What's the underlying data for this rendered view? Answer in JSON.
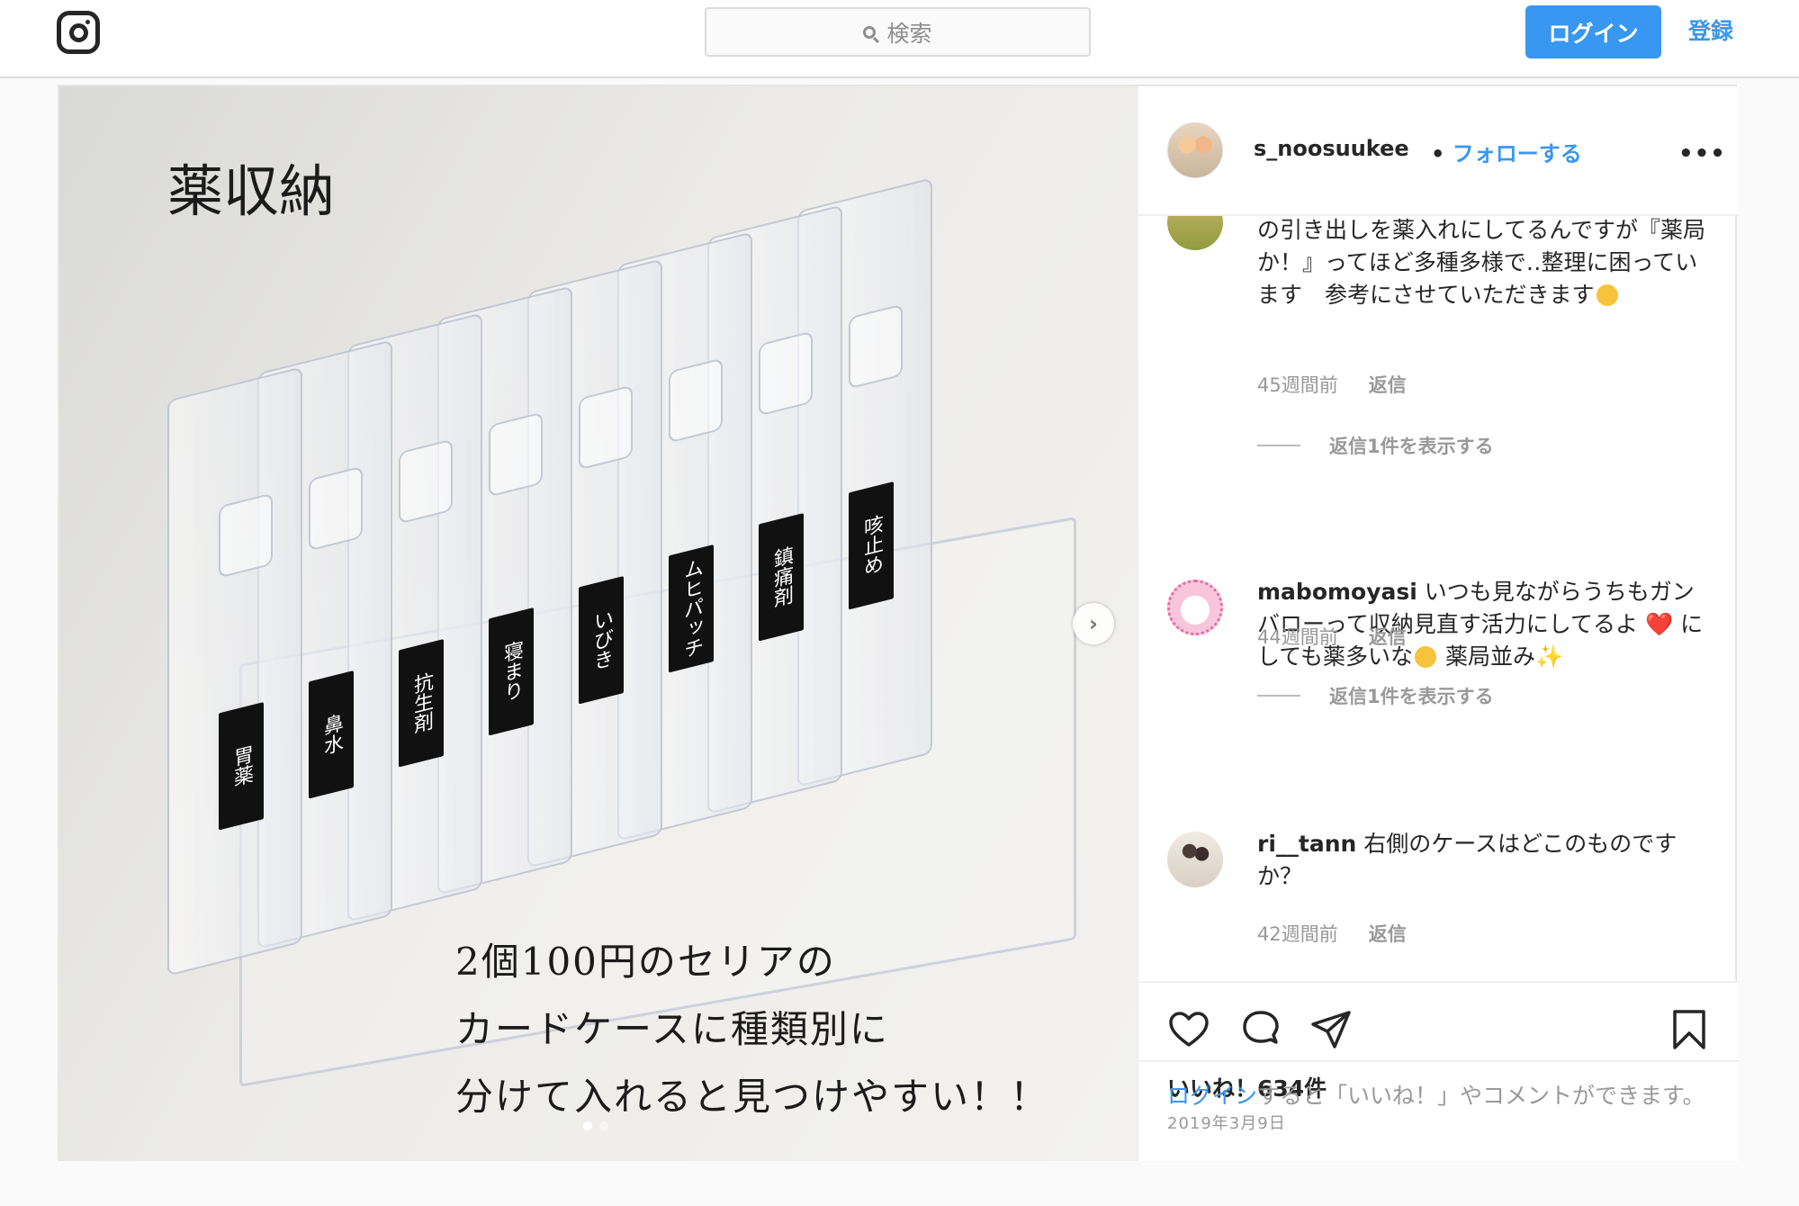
{
  "nav": {
    "search_placeholder": "検索",
    "login_label": "ログイン",
    "signup_label": "登録"
  },
  "media": {
    "title": "薬収納",
    "caption_lines": [
      "2個100円のセリアの",
      "カードケースに種類別に",
      "分けて入れると見つけやすい！！"
    ],
    "case_labels": [
      "胃薬",
      "鼻水",
      "抗生剤",
      "寝まり",
      "いびき",
      "ムヒパッチ",
      "鎮痛剤",
      "咳止め"
    ],
    "carousel": {
      "count": 2,
      "active": 0
    }
  },
  "post_header": {
    "username": "s_noosuukee",
    "separator": "•",
    "follow_label": "フォローする",
    "more_icon": "more-dots-icon"
  },
  "comments": [
    {
      "text": "の引き出しを薬入れにしてるんですが『薬局か！』ってほど多種多様で‥整理に困っています　参考にさせていただきます",
      "emoji": "grinning-emoji",
      "time": "45週間前",
      "reply_label": "返信",
      "view_replies": "返信1件を表示する"
    },
    {
      "username": "mabomoyasi",
      "text_a": "いつも見ながらうちもガンバローって収納見直す活力にしてるよ",
      "heart": "❤️",
      "text_b": "にしても薬多いな",
      "text_c": "薬局並み",
      "sparkle": "✨",
      "time": "44週間前",
      "reply_label": "返信",
      "view_replies": "返信1件を表示する"
    },
    {
      "username": "ri__tann",
      "text": "右側のケースはどこのものですか？",
      "time": "42週間前",
      "reply_label": "返信"
    }
  ],
  "actions": {
    "likes": "いいね！634件",
    "date": "2019年3月9日",
    "login_link": "ログイン",
    "login_text": "すると「いいね！」やコメントができます。"
  },
  "colors": {
    "accent": "#3897f0",
    "border": "#dbdbdb",
    "text": "#262626",
    "muted": "#999999"
  }
}
